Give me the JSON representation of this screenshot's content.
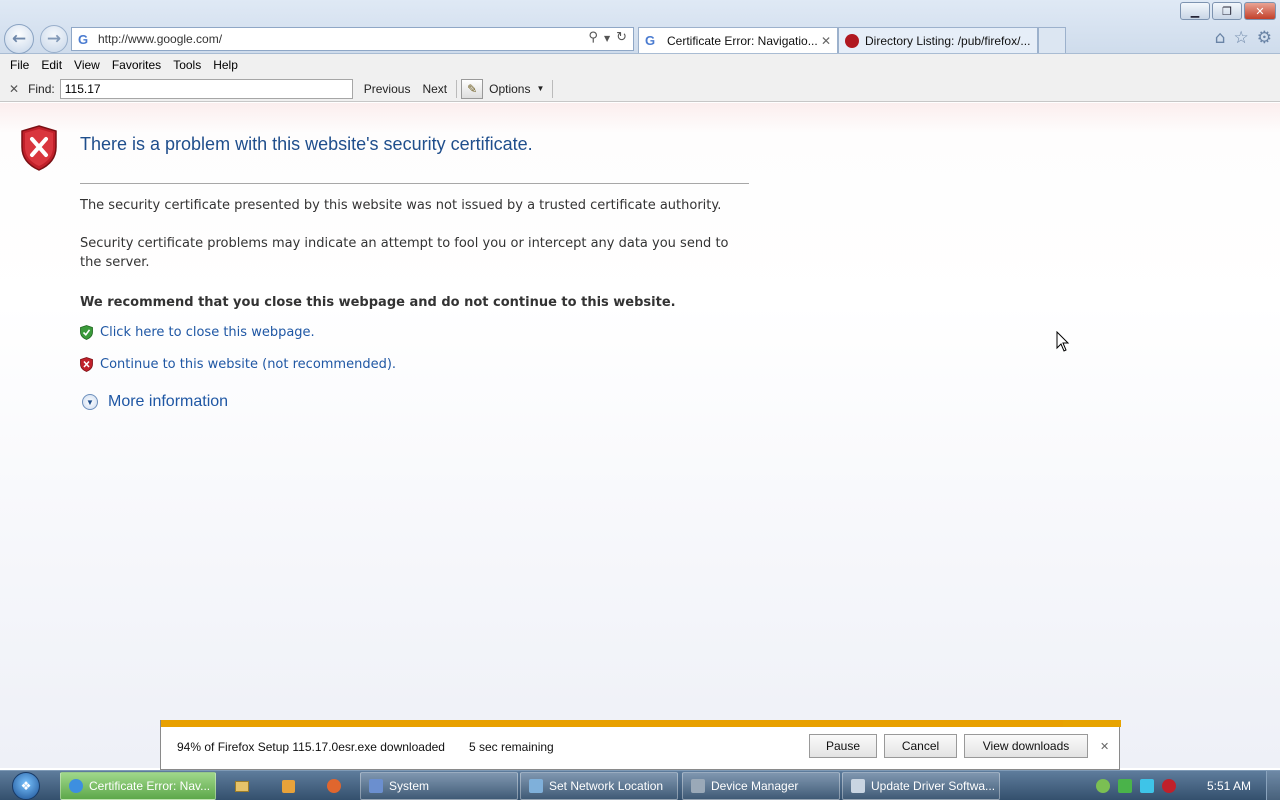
{
  "browser": {
    "address_url": "http://www.google.com/",
    "tabs": [
      {
        "label": "Certificate Error: Navigatio...",
        "active": true,
        "icon": "google-g-icon"
      },
      {
        "label": "Directory Listing: /pub/firefox/...",
        "active": false,
        "icon": "mozilla-dino-icon"
      }
    ],
    "window_controls": {
      "minimize": "▁",
      "restore": "❐",
      "close": "✕"
    }
  },
  "menu": {
    "items": [
      "File",
      "Edit",
      "View",
      "Favorites",
      "Tools",
      "Help"
    ]
  },
  "findbar": {
    "close": "✕",
    "label": "Find:",
    "value": "115.17",
    "previous": "Previous",
    "next": "Next",
    "options": "Options"
  },
  "page": {
    "title": "There is a problem with this website's security certificate.",
    "para1": "The security certificate presented by this website was not issued by a trusted certificate authority.",
    "para2": "Security certificate problems may indicate an attempt to fool you or intercept any data you send to the server.",
    "recommend": "We recommend that you close this webpage and do not continue to this website.",
    "close_link": "Click here to close this webpage.",
    "continue_link": "Continue to this website (not recommended).",
    "more_info": "More information"
  },
  "download": {
    "progress": 0.94,
    "status": "94% of Firefox Setup 115.17.0esr.exe downloaded",
    "remaining": "5 sec remaining",
    "pause": "Pause",
    "cancel": "Cancel",
    "view": "View downloads",
    "close": "✕"
  },
  "taskbar": {
    "windows": [
      {
        "label": "Certificate Error: Nav...",
        "active": true
      },
      {
        "label": "System",
        "active": false
      },
      {
        "label": "Set Network Location",
        "active": false
      },
      {
        "label": "Device Manager",
        "active": false
      },
      {
        "label": "Update Driver Softwa...",
        "active": false
      }
    ],
    "clock": "5:51 AM"
  },
  "colors": {
    "title_blue": "#1f4e8c",
    "link_blue": "#1f57a4",
    "download_progress": "#e8a000",
    "error_red": "#c0202a"
  }
}
